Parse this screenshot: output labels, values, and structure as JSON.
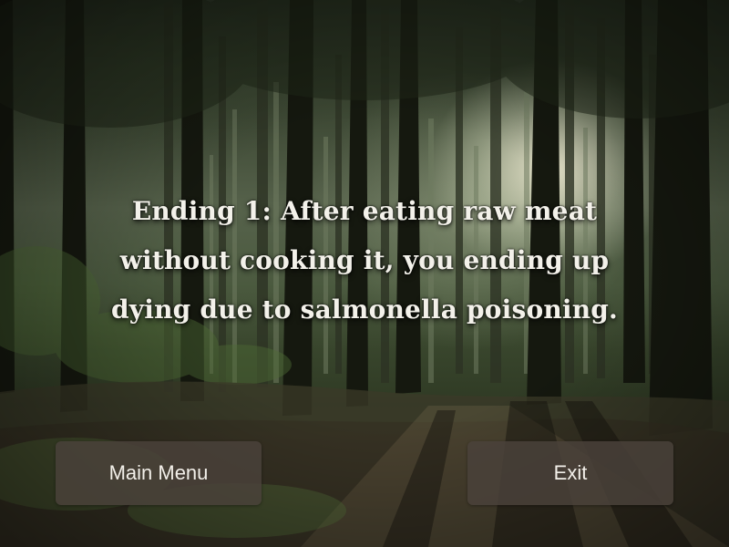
{
  "ending": {
    "text": "Ending 1: After eating raw meat without cooking it, you ending up dying due to salmonella poisoning."
  },
  "buttons": {
    "main_menu_label": "Main Menu",
    "exit_label": "Exit"
  },
  "background": {
    "scene": "forest-background"
  }
}
